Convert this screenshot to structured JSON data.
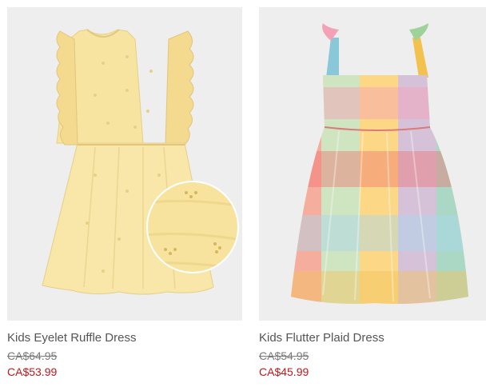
{
  "products": [
    {
      "name": "Kids Eyelet Ruffle Dress",
      "original_price": "CA$64.95",
      "sale_price": "CA$53.99",
      "image_icon": "yellow-eyelet-dress",
      "sale_color": "#c4161c"
    },
    {
      "name": "Kids Flutter Plaid Dress",
      "original_price": "CA$54.95",
      "sale_price": "CA$45.99",
      "image_icon": "plaid-flutter-dress",
      "sale_color": "#c4161c"
    }
  ]
}
